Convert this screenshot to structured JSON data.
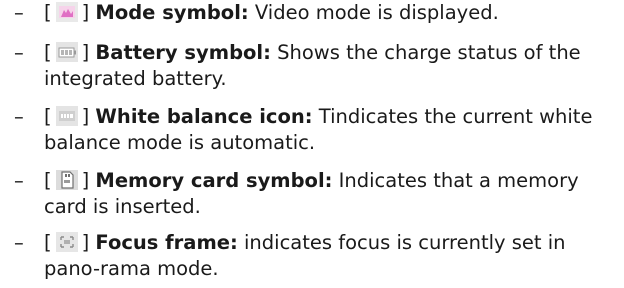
{
  "items": [
    {
      "dash": "–",
      "open": "[",
      "close": "]",
      "icon": "video-mode-icon",
      "term": "Mode symbol:",
      "desc": " Video mode is displayed."
    },
    {
      "dash": "–",
      "open": "[",
      "close": "]",
      "icon": "battery-icon",
      "term": "Battery symbol:",
      "desc": " Shows the charge status of the integrated battery."
    },
    {
      "dash": "–",
      "open": "[",
      "close": "]",
      "icon": "white-balance-auto-icon",
      "term": "White balance icon:",
      "desc": " Tindicates the current white balance mode is automatic."
    },
    {
      "dash": "–",
      "open": "[",
      "close": "]",
      "icon": "memory-card-icon",
      "term": "Memory card symbol:",
      "desc": " Indicates that a memory card is inserted."
    },
    {
      "dash": "–",
      "open": "[",
      "close": "]",
      "icon": "focus-frame-icon",
      "term": "Focus frame:",
      "desc": " indicates focus is currently set in pano-rama mode."
    }
  ]
}
